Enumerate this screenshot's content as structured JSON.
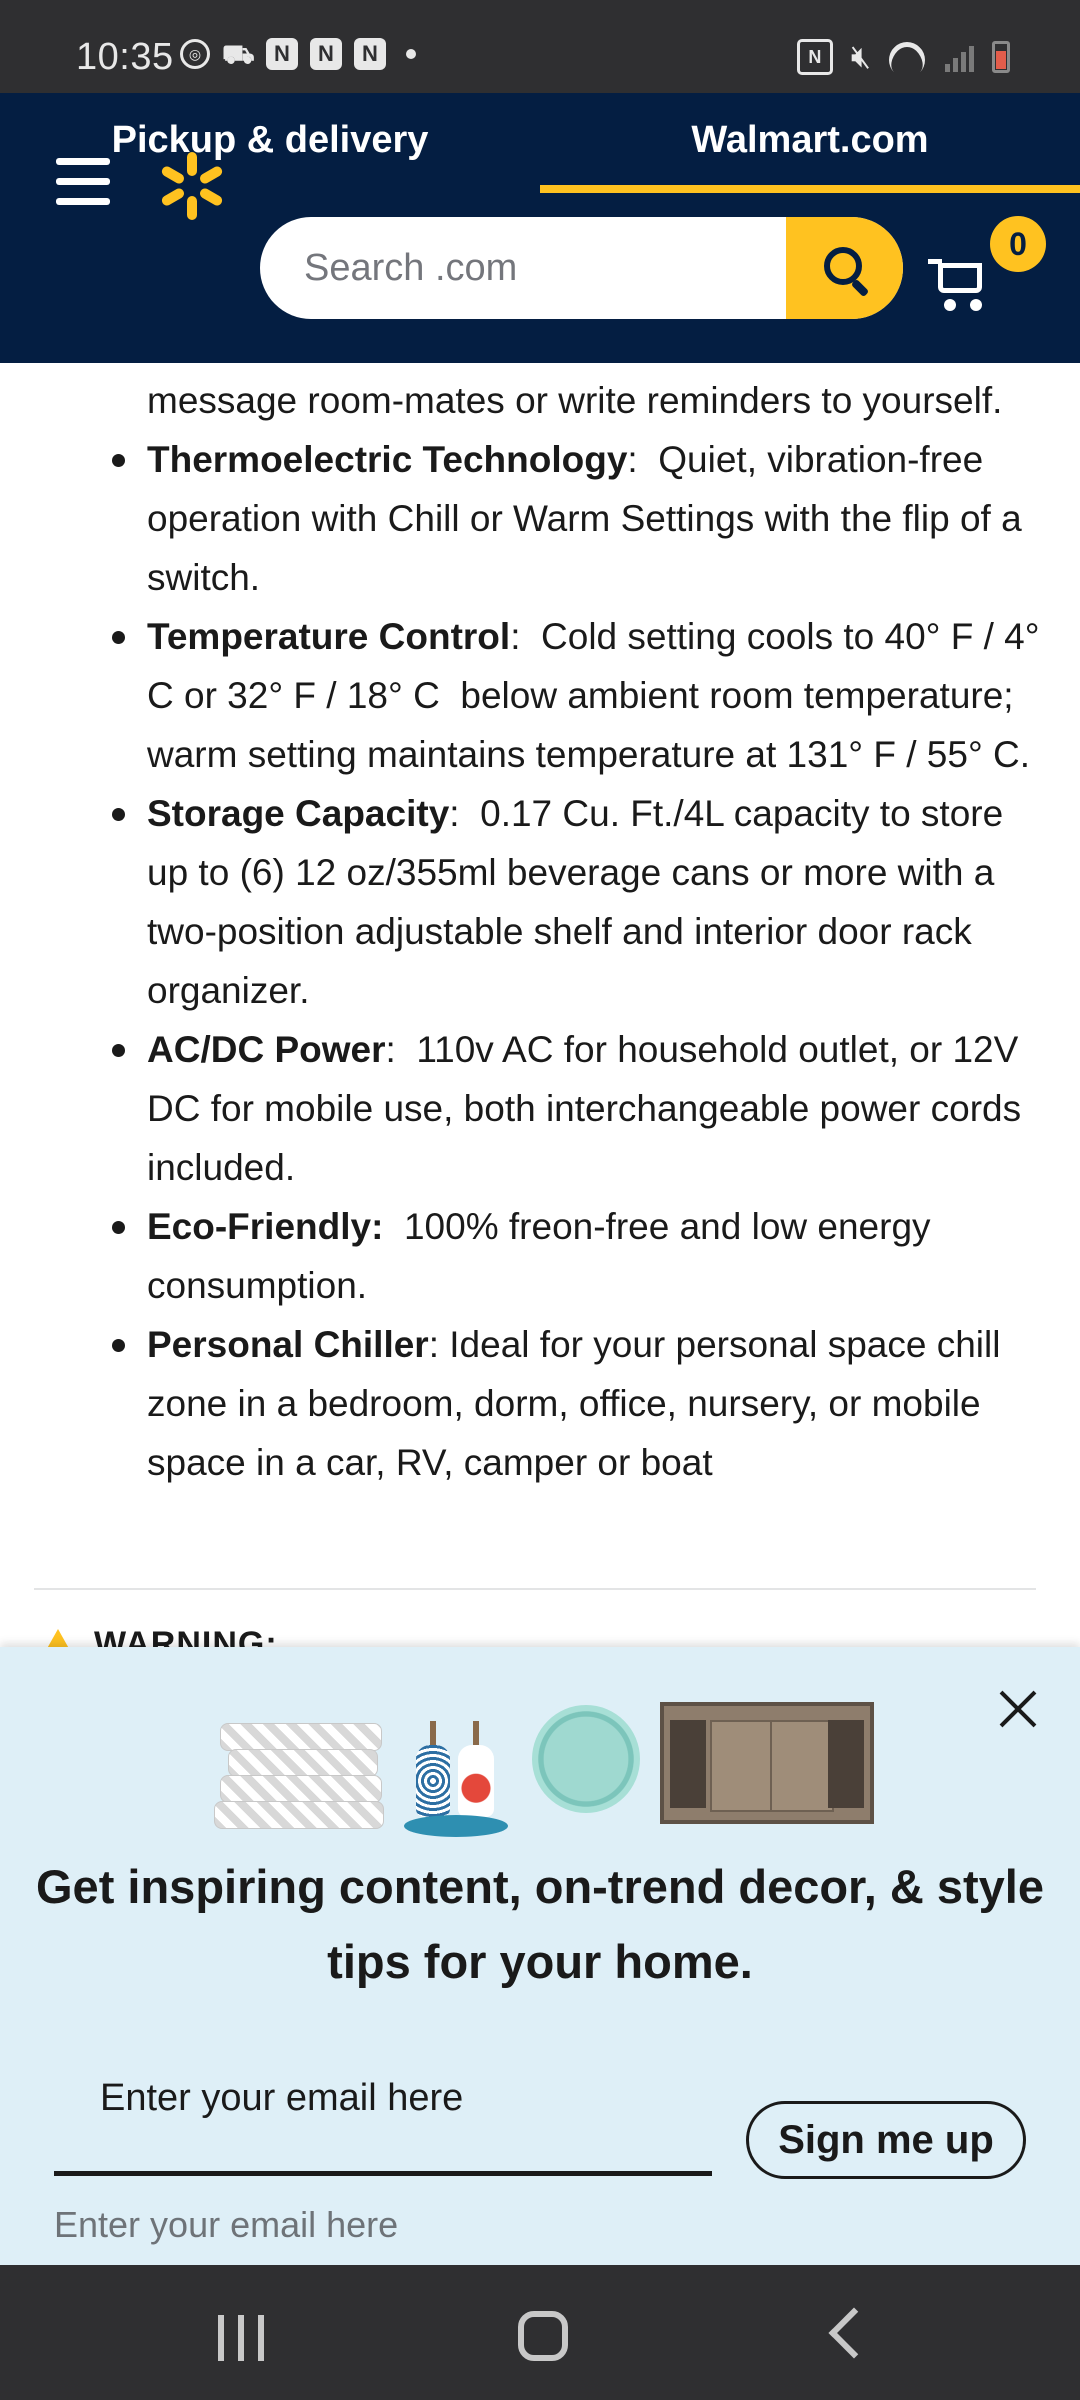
{
  "status_bar": {
    "time": "10:35",
    "left_icons": [
      "sync-icon",
      "cast-icon",
      "n-app-icon",
      "n-app-icon",
      "n-app-icon",
      "dot-icon"
    ],
    "right_icons": [
      "nfc-icon",
      "mute-icon",
      "wifi-icon",
      "signal-icon",
      "battery-low-icon"
    ]
  },
  "header": {
    "tabs": [
      {
        "label": "Pickup & delivery",
        "active": false
      },
      {
        "label": "Walmart.com",
        "active": true
      }
    ],
    "search_placeholder": "Search .com",
    "cart_count": "0",
    "colors": {
      "navy": "#041e42",
      "yellow": "#ffc220"
    }
  },
  "content": {
    "partial_line": "message room-mates or write reminders to yourself.",
    "features": [
      {
        "title": "Thermoelectric Technology",
        "sep": ":",
        "text": "  Quiet, vibration-free operation with Chill or Warm Settings with the flip of a switch."
      },
      {
        "title": "Temperature Control",
        "sep": ":",
        "text": "  Cold setting cools to 40° F / 4° C or 32° F / 18° C  below ambient room temperature; warm setting maintains temperature at 131° F / 55° C."
      },
      {
        "title": "Storage Capacity",
        "sep": ":",
        "text": "  0.17 Cu. Ft./4L capacity to store up to (6) 12 oz/355ml beverage cans or more with a two-position adjustable shelf and interior door rack organizer."
      },
      {
        "title": "AC/DC Power",
        "sep": ":",
        "text": "  110v AC for household outlet, or 12V DC for mobile use, both interchangeable power cords included."
      },
      {
        "title": "Eco-Friendly:",
        "sep": "",
        "text": "  100% freon-free and low energy consumption."
      },
      {
        "title": "Personal Chiller",
        "sep": ":",
        "text": " Ideal for your personal space chill zone in a bedroom, dorm, office, nursery, or mobile space in a car, RV, camper or boat"
      }
    ],
    "warning_label": "WARNING:"
  },
  "promo": {
    "title": "Get inspiring content, on-trend decor, & style tips for your home.",
    "email_label": "Enter your email here",
    "signup_label": "Sign me up",
    "email_placeholder": "Enter your email here",
    "product_icons": [
      "towels-image",
      "soap-dispenser-image",
      "plate-image",
      "tv-cabinet-image"
    ]
  },
  "nav_bar": {
    "buttons": [
      "recent-apps-icon",
      "home-icon",
      "back-icon"
    ]
  }
}
